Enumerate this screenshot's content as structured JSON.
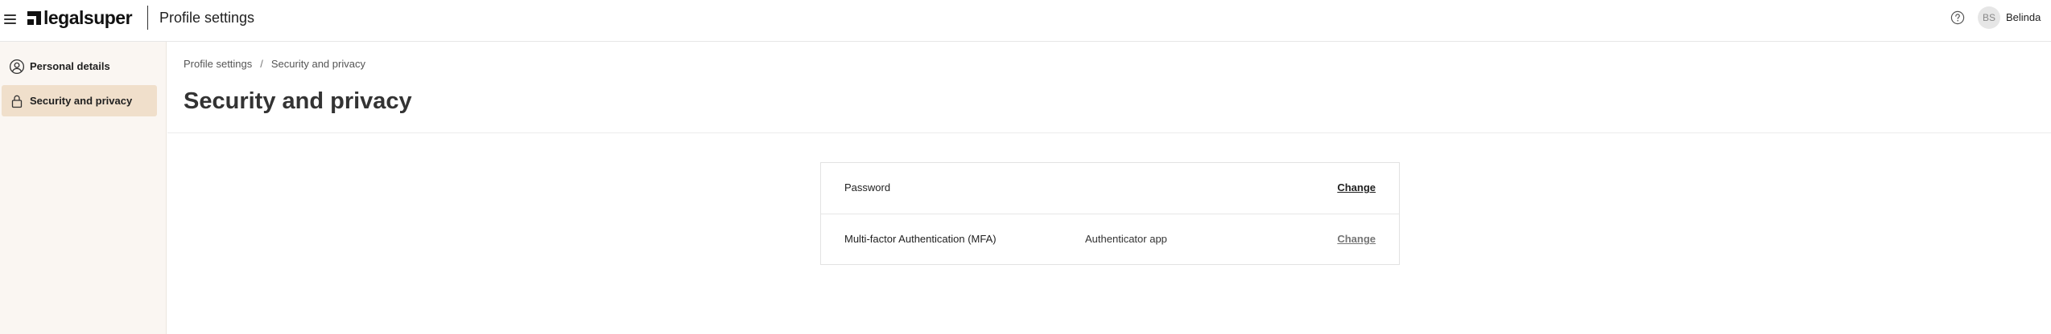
{
  "header": {
    "brand": "legalsuper",
    "app_title": "Profile settings",
    "user": {
      "initials": "BS",
      "name": "Belinda"
    }
  },
  "sidebar": {
    "items": [
      {
        "label": "Personal details",
        "icon": "user-circle-icon",
        "active": false
      },
      {
        "label": "Security and privacy",
        "icon": "lock-icon",
        "active": true
      }
    ]
  },
  "breadcrumb": {
    "items": [
      "Profile settings",
      "Security and privacy"
    ],
    "separator": "/"
  },
  "page": {
    "title": "Security and privacy"
  },
  "settings": {
    "rows": [
      {
        "label": "Password",
        "value": "",
        "action": "Change"
      },
      {
        "label": "Multi-factor Authentication (MFA)",
        "value": "Authenticator app",
        "action": "Change"
      }
    ]
  },
  "colors": {
    "sidebar_bg": "#faf6f2",
    "active_item_bg": "#f0dfcb",
    "title_text": "#333333"
  }
}
